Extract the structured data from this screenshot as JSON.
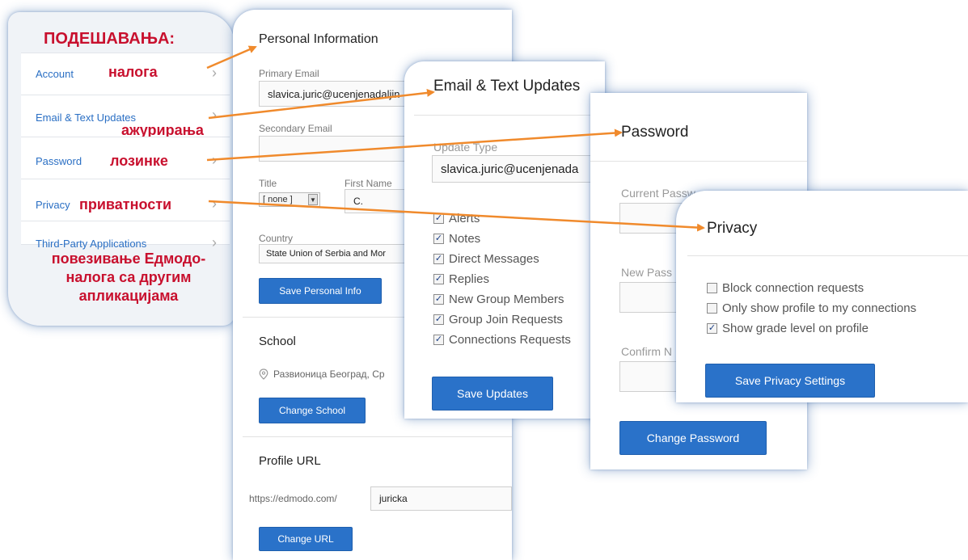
{
  "nav": {
    "heading": "ПОДЕШАВАЊА:",
    "items": [
      {
        "label": "Account",
        "note": "налога"
      },
      {
        "label": "Email & Text Updates",
        "note": "ажурирања"
      },
      {
        "label": "Password",
        "note": "лозинке"
      },
      {
        "label": "Privacy",
        "note": "приватности"
      },
      {
        "label": "Third-Party Applications",
        "note": "повезивање Едмодо-налога са другим апликацијама"
      }
    ],
    "note_lines": [
      "повезивање Едмодо-",
      "налога са другим",
      "апликацијама"
    ]
  },
  "personal": {
    "title": "Personal Information",
    "primary_email_label": "Primary Email",
    "primary_email_value": "slavica.juric@ucenjenadaljin",
    "secondary_email_label": "Secondary Email",
    "secondary_email_value": "",
    "title_label": "Title",
    "title_value": "[ none ]",
    "first_name_label": "First Name",
    "first_name_value": "C.",
    "country_label": "Country",
    "country_value": "State Union of Serbia and Mor",
    "save_button": "Save Personal Info",
    "school_title": "School",
    "school_value": "Развионица Београд, Ср",
    "change_school_button": "Change School",
    "profile_url_title": "Profile URL",
    "profile_url_prefix": "https://edmodo.com/",
    "profile_url_value": "juricka",
    "change_url_button": "Change URL"
  },
  "email": {
    "title": "Email & Text Updates",
    "update_type_label": "Update Type",
    "update_type_value": "slavica.juric@ucenjenada",
    "options": [
      {
        "label": "Alerts",
        "checked": true
      },
      {
        "label": "Notes",
        "checked": true
      },
      {
        "label": "Direct Messages",
        "checked": true
      },
      {
        "label": "Replies",
        "checked": true
      },
      {
        "label": "New Group Members",
        "checked": true
      },
      {
        "label": "Group Join Requests",
        "checked": true
      },
      {
        "label": "Connections Requests",
        "checked": true
      }
    ],
    "save_button": "Save Updates"
  },
  "password": {
    "title": "Password",
    "current_label": "Current Passw",
    "new_label": "New Pass",
    "confirm_label": "Confirm N",
    "change_button": "Change Password"
  },
  "privacy": {
    "title": "Privacy",
    "options": [
      {
        "label": "Block connection requests",
        "checked": false
      },
      {
        "label": "Only show profile to my connections",
        "checked": false
      },
      {
        "label": "Show grade level on profile",
        "checked": true
      }
    ],
    "save_button": "Save Privacy Settings"
  },
  "colors": {
    "accent": "#2a72c9",
    "arrow": "#f08a2c",
    "annotation": "#c8102e"
  }
}
